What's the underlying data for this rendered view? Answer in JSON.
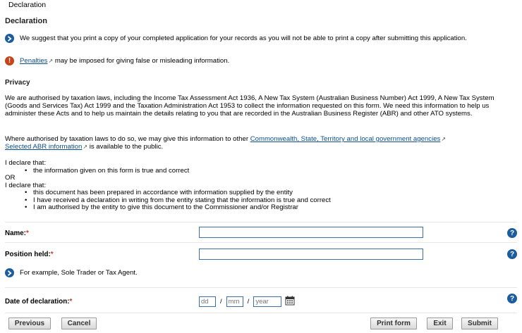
{
  "header": {
    "tab_title": "Declaration",
    "page_title": "Declaration"
  },
  "messages": {
    "print_suggestion": "We suggest that you print a copy of your completed application for your records as you will not be able to print a copy after submitting this application.",
    "penalties_link": "Penalties",
    "penalties_text": " may be imposed for giving false or misleading information."
  },
  "privacy": {
    "title": "Privacy",
    "para1": "We are authorised by taxation laws, including the Income Tax Assessment Act 1936, A New Tax System (Australian Business Number) Act 1999, A New Tax System (Goods and Services Tax) Act 1999 and the Taxation Administration Act 1953 to collect the information requested on this form. We need this information to help us administer these Acts and to help us maintain the details relating to you that are recorded in the Australian Business Register (ABR) and other ATO systems.",
    "para2_prefix": "Where authorised by taxation laws to do so, we may give this information to other ",
    "para2_link1": "Commonwealth, State, Territory and local government agencies",
    "para2_link2": "Selected ABR information",
    "para2_suffix": " is available to the public."
  },
  "declaration": {
    "intro1": "I declare that:",
    "items1": [
      "the information given on this form is true and correct"
    ],
    "or": "OR",
    "intro2": "I declare that:",
    "items2": [
      "this document has been prepared in accordance with information supplied by the entity",
      "I have received a declaration in writing from the entity stating that the information is true and correct",
      "I am authorised by the entity to give this document to the Commissioner and/or Registrar"
    ]
  },
  "form": {
    "name_label": "Name:",
    "name_value": "",
    "position_label": "Position held:",
    "position_value": "",
    "position_hint": "For example, Sole Trader or Tax Agent.",
    "date_label": "Date of declaration:",
    "required_marker": "*",
    "date_day_placeholder": "dd",
    "date_month_placeholder": "mm",
    "date_year_placeholder": "year",
    "date_separator": "/"
  },
  "buttons": {
    "previous": "Previous",
    "cancel": "Cancel",
    "print_form": "Print form",
    "exit": "Exit",
    "submit": "Submit"
  },
  "icons": {
    "info": "info-chevron-icon",
    "warning": "warning-icon",
    "help": "help-icon",
    "calendar": "calendar-icon",
    "external_link": "external-link-icon"
  },
  "colors": {
    "accent": "#1c5d9e",
    "warning": "#c8421a",
    "link": "#0b4e8a",
    "required": "#c0392b"
  }
}
